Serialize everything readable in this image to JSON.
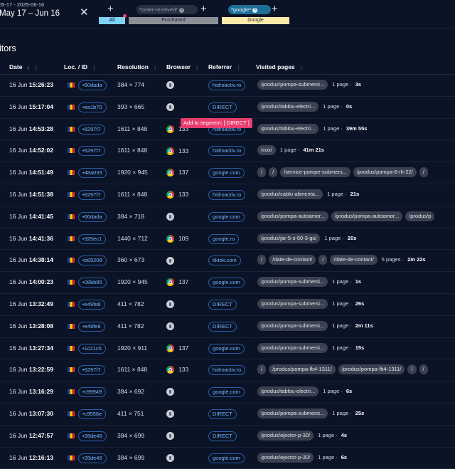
{
  "date_filter": {
    "range_short": "05-17 - 2025-06-16",
    "range_label": "May 17 – Jun 16",
    "clear_glyph": "✕"
  },
  "segments": {
    "add_glyph": "+",
    "all_label": "All",
    "purchased_label": "Purchased",
    "purchased_chip": "*order-received*",
    "google_label": "Google",
    "google_chip": "*google*",
    "chip_remove_glyph": "×"
  },
  "section_title": "itors",
  "columns": {
    "date": "Date",
    "date_sort_glyph": "↓",
    "location": "Loc. / ID",
    "resolution": "Resolution",
    "browser": "Browser",
    "referrer": "Referrer",
    "visited_pages": "Visited pages",
    "menu_glyph": "⋮"
  },
  "tooltip": "Add to segment: [ DIRECT ]",
  "rows": [
    {
      "day": "16 Jun",
      "time": "15:26:23",
      "id": "•60dada",
      "res": "384 × 774",
      "browser": "generic",
      "ver": "",
      "ref": "hidroactiv.ro",
      "pages": [
        "/produs/pompa-submersi..."
      ],
      "count": "1 page ·",
      "dur": "3s"
    },
    {
      "day": "16 Jun",
      "time": "15:17:04",
      "id": "•ea1b70",
      "res": "393 × 665",
      "browser": "generic",
      "ver": "",
      "ref": "DIRECT",
      "pages": [
        "/produs/tablou-electri..."
      ],
      "count": "1 page ·",
      "dur": "0s"
    },
    {
      "day": "16 Jun",
      "time": "14:53:28",
      "id": "•6297f7",
      "res": "1611 × 848",
      "browser": "chrome",
      "ver": "133",
      "ref": "hidroactiv.ro",
      "pages": [
        "/produs/tablou-electri..."
      ],
      "count": "1 page ·",
      "dur": "39m 55s"
    },
    {
      "day": "16 Jun",
      "time": "14:52:02",
      "id": "•6297f7",
      "res": "1611 × 848",
      "browser": "chrome",
      "ver": "133",
      "ref": "hidroactiv.ro",
      "pages": [
        "/cos/"
      ],
      "count": "1 page ·",
      "dur": "41m 21s"
    },
    {
      "day": "16 Jun",
      "time": "14:51:49",
      "id": "•48a033",
      "res": "1920 × 945",
      "browser": "chrome",
      "ver": "137",
      "ref": "google.com",
      "pages": [
        "/",
        "/",
        "/service-pompe-submers...",
        "/produs/pompa-6-rh-22/",
        "/"
      ],
      "count": "",
      "dur": ""
    },
    {
      "day": "16 Jun",
      "time": "14:51:38",
      "id": "•6297f7",
      "res": "1611 × 848",
      "browser": "chrome",
      "ver": "133",
      "ref": "hidroactiv.ro",
      "pages": [
        "/produs/cablu-alimenta..."
      ],
      "count": "1 page ·",
      "dur": "21s"
    },
    {
      "day": "16 Jun",
      "time": "14:41:45",
      "id": "•60dada",
      "res": "384 × 718",
      "browser": "generic",
      "ver": "",
      "ref": "google.com",
      "pages": [
        "/produs/pompa-autoamor...",
        "/produs/pompa-autoamor...",
        "/produs/p"
      ],
      "count": "",
      "dur": ""
    },
    {
      "day": "16 Jun",
      "time": "14:41:36",
      "id": "•325ec1",
      "res": "1440 × 712",
      "browser": "chrome",
      "ver": "109",
      "ref": "google.ro",
      "pages": [
        "/produs/jar-5-s-50-3-gs/"
      ],
      "count": "1 page ·",
      "dur": "20s"
    },
    {
      "day": "16 Jun",
      "time": "14:38:14",
      "id": "•b89208",
      "res": "360 × 673",
      "browser": "generic",
      "ver": "",
      "ref": "tiktok.com",
      "pages": [
        "/",
        "/date-de-contact/",
        "/",
        "/date-de-contact/"
      ],
      "count": "5 pages ·",
      "dur": "2m 22s"
    },
    {
      "day": "16 Jun",
      "time": "14:00:23",
      "id": "•08bb85",
      "res": "1920 × 945",
      "browser": "chrome",
      "ver": "137",
      "ref": "google.com",
      "pages": [
        "/produs/pompa-submersi..."
      ],
      "count": "1 page ·",
      "dur": "1s"
    },
    {
      "day": "16 Jun",
      "time": "13:32:49",
      "id": "•e49fe8",
      "res": "411 × 782",
      "browser": "generic",
      "ver": "",
      "ref": "DIRECT",
      "pages": [
        "/produs/pompa-submersi..."
      ],
      "count": "1 page ·",
      "dur": "26s"
    },
    {
      "day": "16 Jun",
      "time": "13:28:08",
      "id": "•e49fe8",
      "res": "411 × 782",
      "browser": "generic",
      "ver": "",
      "ref": "DIRECT",
      "pages": [
        "/produs/pompa-submersi..."
      ],
      "count": "1 page ·",
      "dur": "2m 11s"
    },
    {
      "day": "16 Jun",
      "time": "13:27:34",
      "id": "•1c21c5",
      "res": "1920 × 911",
      "browser": "chrome",
      "ver": "137",
      "ref": "google.com",
      "pages": [
        "/produs/pompa-submersi..."
      ],
      "count": "1 page ·",
      "dur": "15s"
    },
    {
      "day": "16 Jun",
      "time": "13:22:59",
      "id": "•6297f7",
      "res": "1611 × 848",
      "browser": "chrome",
      "ver": "133",
      "ref": "hidroactiv.ro",
      "pages": [
        "/",
        "/produs/pompa-fb4-1311/",
        "/produs/pompa-fb4-1311/",
        "/",
        "/"
      ],
      "count": "",
      "dur": ""
    },
    {
      "day": "16 Jun",
      "time": "13:16:29",
      "id": "•c99949",
      "res": "384 × 692",
      "browser": "generic",
      "ver": "",
      "ref": "google.com",
      "pages": [
        "/produs/tablou-electri..."
      ],
      "count": "1 page ·",
      "dur": "6s"
    },
    {
      "day": "16 Jun",
      "time": "13:07:30",
      "id": "•c9556e",
      "res": "411 × 751",
      "browser": "generic",
      "ver": "",
      "ref": "DIRECT",
      "pages": [
        "/produs/pompa-submersi..."
      ],
      "count": "1 page ·",
      "dur": "25s"
    },
    {
      "day": "16 Jun",
      "time": "12:47:57",
      "id": "•28de46",
      "res": "384 × 699",
      "browser": "generic",
      "ver": "",
      "ref": "DIRECT",
      "pages": [
        "/produs/ejector-p-30/"
      ],
      "count": "1 page ·",
      "dur": "4s"
    },
    {
      "day": "16 Jun",
      "time": "12:16:13",
      "id": "•28de46",
      "res": "384 × 699",
      "browser": "generic",
      "ver": "",
      "ref": "google.com",
      "pages": [
        "/produs/ejector-p-30/"
      ],
      "count": "1 page ·",
      "dur": "6s"
    }
  ]
}
